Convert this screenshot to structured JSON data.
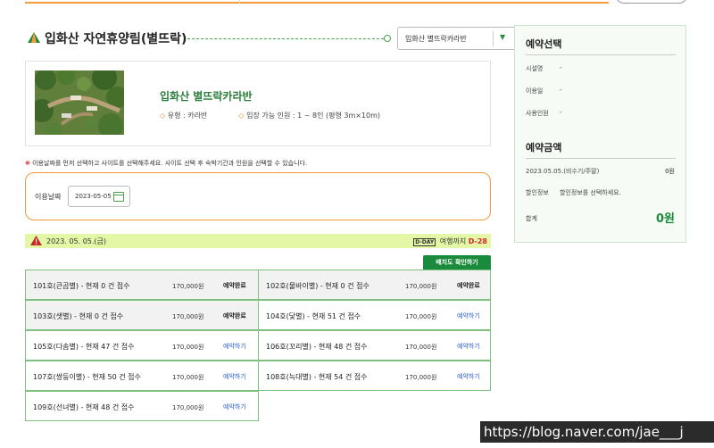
{
  "header": {
    "title": "입화산 자연휴양림(별뜨락)",
    "site_select_value": "입화산 별뜨락카라반"
  },
  "site": {
    "name": "입화산 별뜨락카라반",
    "type_label": "유형 : 카라반",
    "capacity_label": "입장 가능 인원 : 1 ~ 8인 (평형 3m×10m)"
  },
  "notice": "이용날짜를 먼저 선택하고 사이트를 선택해주세요. 사이트 선택 후 숙박기간과 인원을 선택할 수 있습니다.",
  "date_picker": {
    "label": "이용날짜",
    "value": "2023-05-05"
  },
  "day_bar": {
    "date": "2023. 05. 05.(금)",
    "dday_prefix": "여행까지",
    "dday": "D-28",
    "cal_mini": "D-DAY"
  },
  "map_button": "배치도 확인하기",
  "rooms": [
    {
      "name": "101호(큰곰별) - 현재 0 건 접수",
      "price": "170,000원",
      "status": "예약완료",
      "booked": true
    },
    {
      "name": "102호(물바이별) - 현재 0 건 접수",
      "price": "170,000원",
      "status": "예약완료",
      "booked": true
    },
    {
      "name": "103호(샛별) - 현재 0 건 접수",
      "price": "170,000원",
      "status": "예약완료",
      "booked": true
    },
    {
      "name": "104호(닻별) - 현재 51 건 접수",
      "price": "170,000원",
      "status": "예약하기",
      "booked": false
    },
    {
      "name": "105호(다솜별) - 현재 47 건 접수",
      "price": "170,000원",
      "status": "예약하기",
      "booked": false
    },
    {
      "name": "106호(꼬리별) - 현재 48 건 접수",
      "price": "170,000원",
      "status": "예약하기",
      "booked": false
    },
    {
      "name": "107호(쌍둥이별) - 현재 50 건 접수",
      "price": "170,000원",
      "status": "예약하기",
      "booked": false
    },
    {
      "name": "108호(늑대별) - 현재 54 건 접수",
      "price": "170,000원",
      "status": "예약하기",
      "booked": false
    },
    {
      "name": "109호(선녀별) - 현재 48 건 접수",
      "price": "170,000원",
      "status": "예약하기",
      "booked": false
    }
  ],
  "panel": {
    "select_title": "예약선택",
    "facility_label": "시설명",
    "facility_value": "-",
    "date_label": "이용일",
    "date_value": "-",
    "people_label": "사용인원",
    "people_value": "-",
    "price_title": "예약금액",
    "price_row_label": "2023.05.05.(비수기/주말)",
    "price_row_value": "0원",
    "discount_label": "할인정보",
    "discount_value": "할인정보를 선택하세요.",
    "total_label": "합계",
    "total_value": "0원"
  },
  "watermark": "https://blog.naver.com/jae___j",
  "colors": {
    "accent_orange": "#f29b3a",
    "brand_green": "#1a8a3c",
    "link_blue": "#2b5fd9",
    "day_bar_bg": "#e3f7a6"
  }
}
